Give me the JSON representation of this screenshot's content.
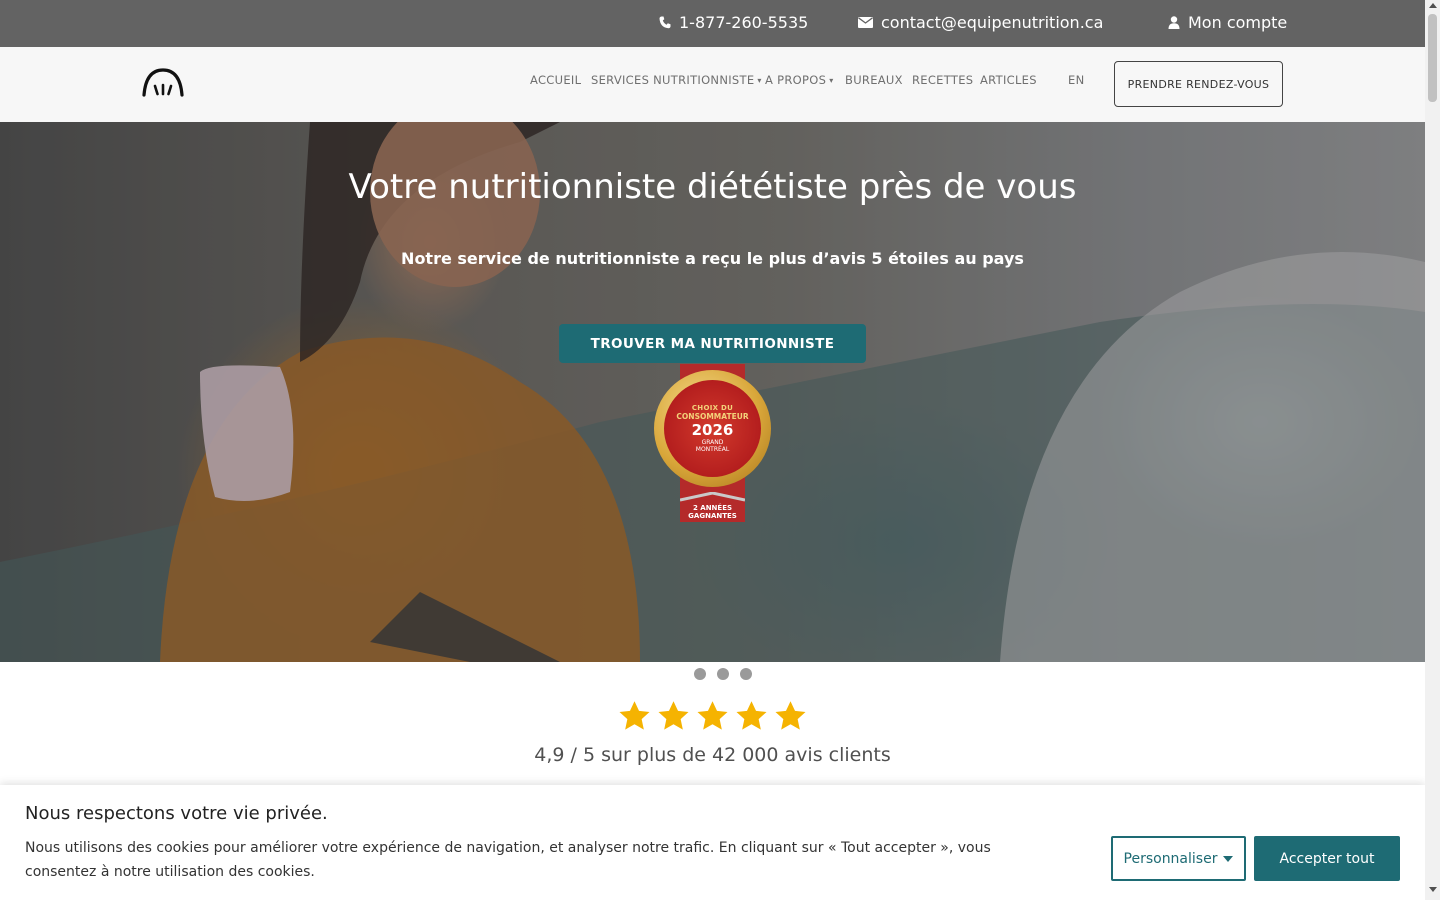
{
  "topbar": {
    "phone": "1-877-260-5535",
    "email": "contact@equipenutrition.ca",
    "account": "Mon compte",
    "phone_icon": "phone-icon",
    "email_icon": "envelope-icon",
    "account_icon": "user-icon"
  },
  "nav": {
    "logo_icon": "equipe-nutrition-logo",
    "items": [
      {
        "label": "ACCUEIL",
        "dropdown": false
      },
      {
        "label": "SERVICES NUTRITIONNISTE",
        "dropdown": true
      },
      {
        "label": "A PROPOS",
        "dropdown": true
      },
      {
        "label": "BUREAUX",
        "dropdown": false
      },
      {
        "label": "RECETTES",
        "dropdown": false
      },
      {
        "label": "ARTICLES",
        "dropdown": false
      }
    ],
    "lang": "EN",
    "cta": "PRENDRE RENDEZ-VOUS"
  },
  "hero": {
    "title": "Votre nutritionniste diététiste près de vous",
    "subtitle": "Notre service de nutritionniste a reçu le plus d’avis 5 étoiles au pays",
    "cta": "TROUVER MA NUTRITIONNISTE",
    "badge": {
      "line1": "CHOIX DU",
      "line2": "CONSOMMATEUR",
      "year": "2026",
      "line3": "GRAND",
      "line4": "MONTRÉAL",
      "ribbon": "2 ANNÉES GAGNANTES"
    },
    "slides": 3
  },
  "rating": {
    "stars": 5,
    "text": "4,9 / 5 sur plus de 42 000 avis clients",
    "star_color": "#f5b301"
  },
  "cookie": {
    "title": "Nous respectons votre vie privée.",
    "text": "Nous utilisons des cookies pour améliorer votre expérience de navigation, et analyser notre trafic. En cliquant sur « Tout accepter », vous consentez à notre utilisation des cookies.",
    "customize": "Personnaliser",
    "accept": "Accepter tout"
  },
  "colors": {
    "accent": "#1e6b74",
    "topbar": "#636363"
  }
}
